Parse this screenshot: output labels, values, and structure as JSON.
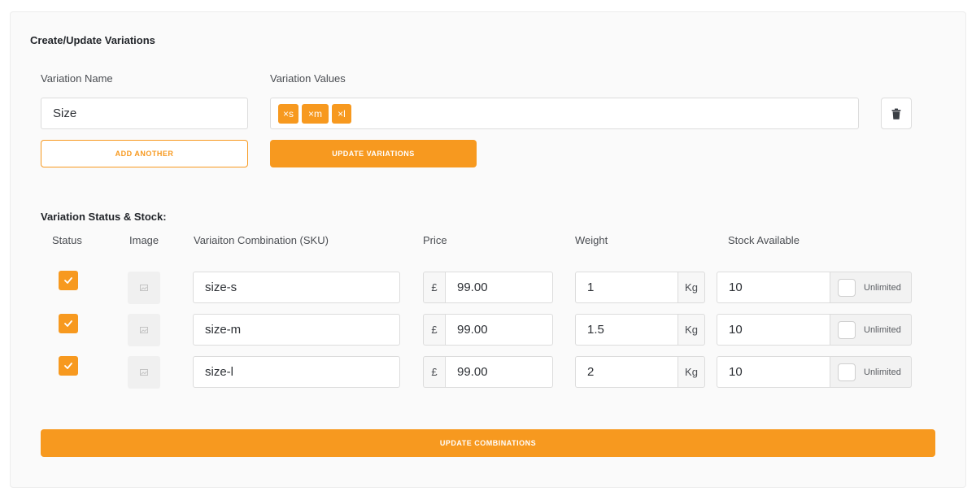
{
  "form": {
    "title": "Create/Update Variations",
    "variation_name_label": "Variation Name",
    "variation_values_label": "Variation Values",
    "variation_name_value": "Size",
    "tags": [
      {
        "label": "×s"
      },
      {
        "label": "×m"
      },
      {
        "label": "×l"
      }
    ],
    "add_another_label": "ADD ANOTHER",
    "update_variations_label": "UPDATE VARIATIONS",
    "delete_icon": "trash-icon"
  },
  "stock": {
    "title": "Variation Status & Stock:",
    "columns": {
      "status": "Status",
      "image": "Image",
      "sku": "Variaiton Combination (SKU)",
      "price": "Price",
      "weight": "Weight",
      "stock": "Stock Available"
    },
    "currency_symbol": "£",
    "weight_unit": "Kg",
    "unlimited_label": "Unlimited",
    "rows": [
      {
        "checked": true,
        "sku": "size-s",
        "price": "99.00",
        "weight": "1",
        "stock": "10"
      },
      {
        "checked": true,
        "sku": "size-m",
        "price": "99.00",
        "weight": "1.5",
        "stock": "10"
      },
      {
        "checked": true,
        "sku": "size-l",
        "price": "99.00",
        "weight": "2",
        "stock": "10"
      }
    ],
    "update_combinations_label": "UPDATE COMBINATIONS"
  },
  "colors": {
    "accent": "#f7991f",
    "card_background": "#fafafa",
    "border": "#dcdcdc"
  }
}
